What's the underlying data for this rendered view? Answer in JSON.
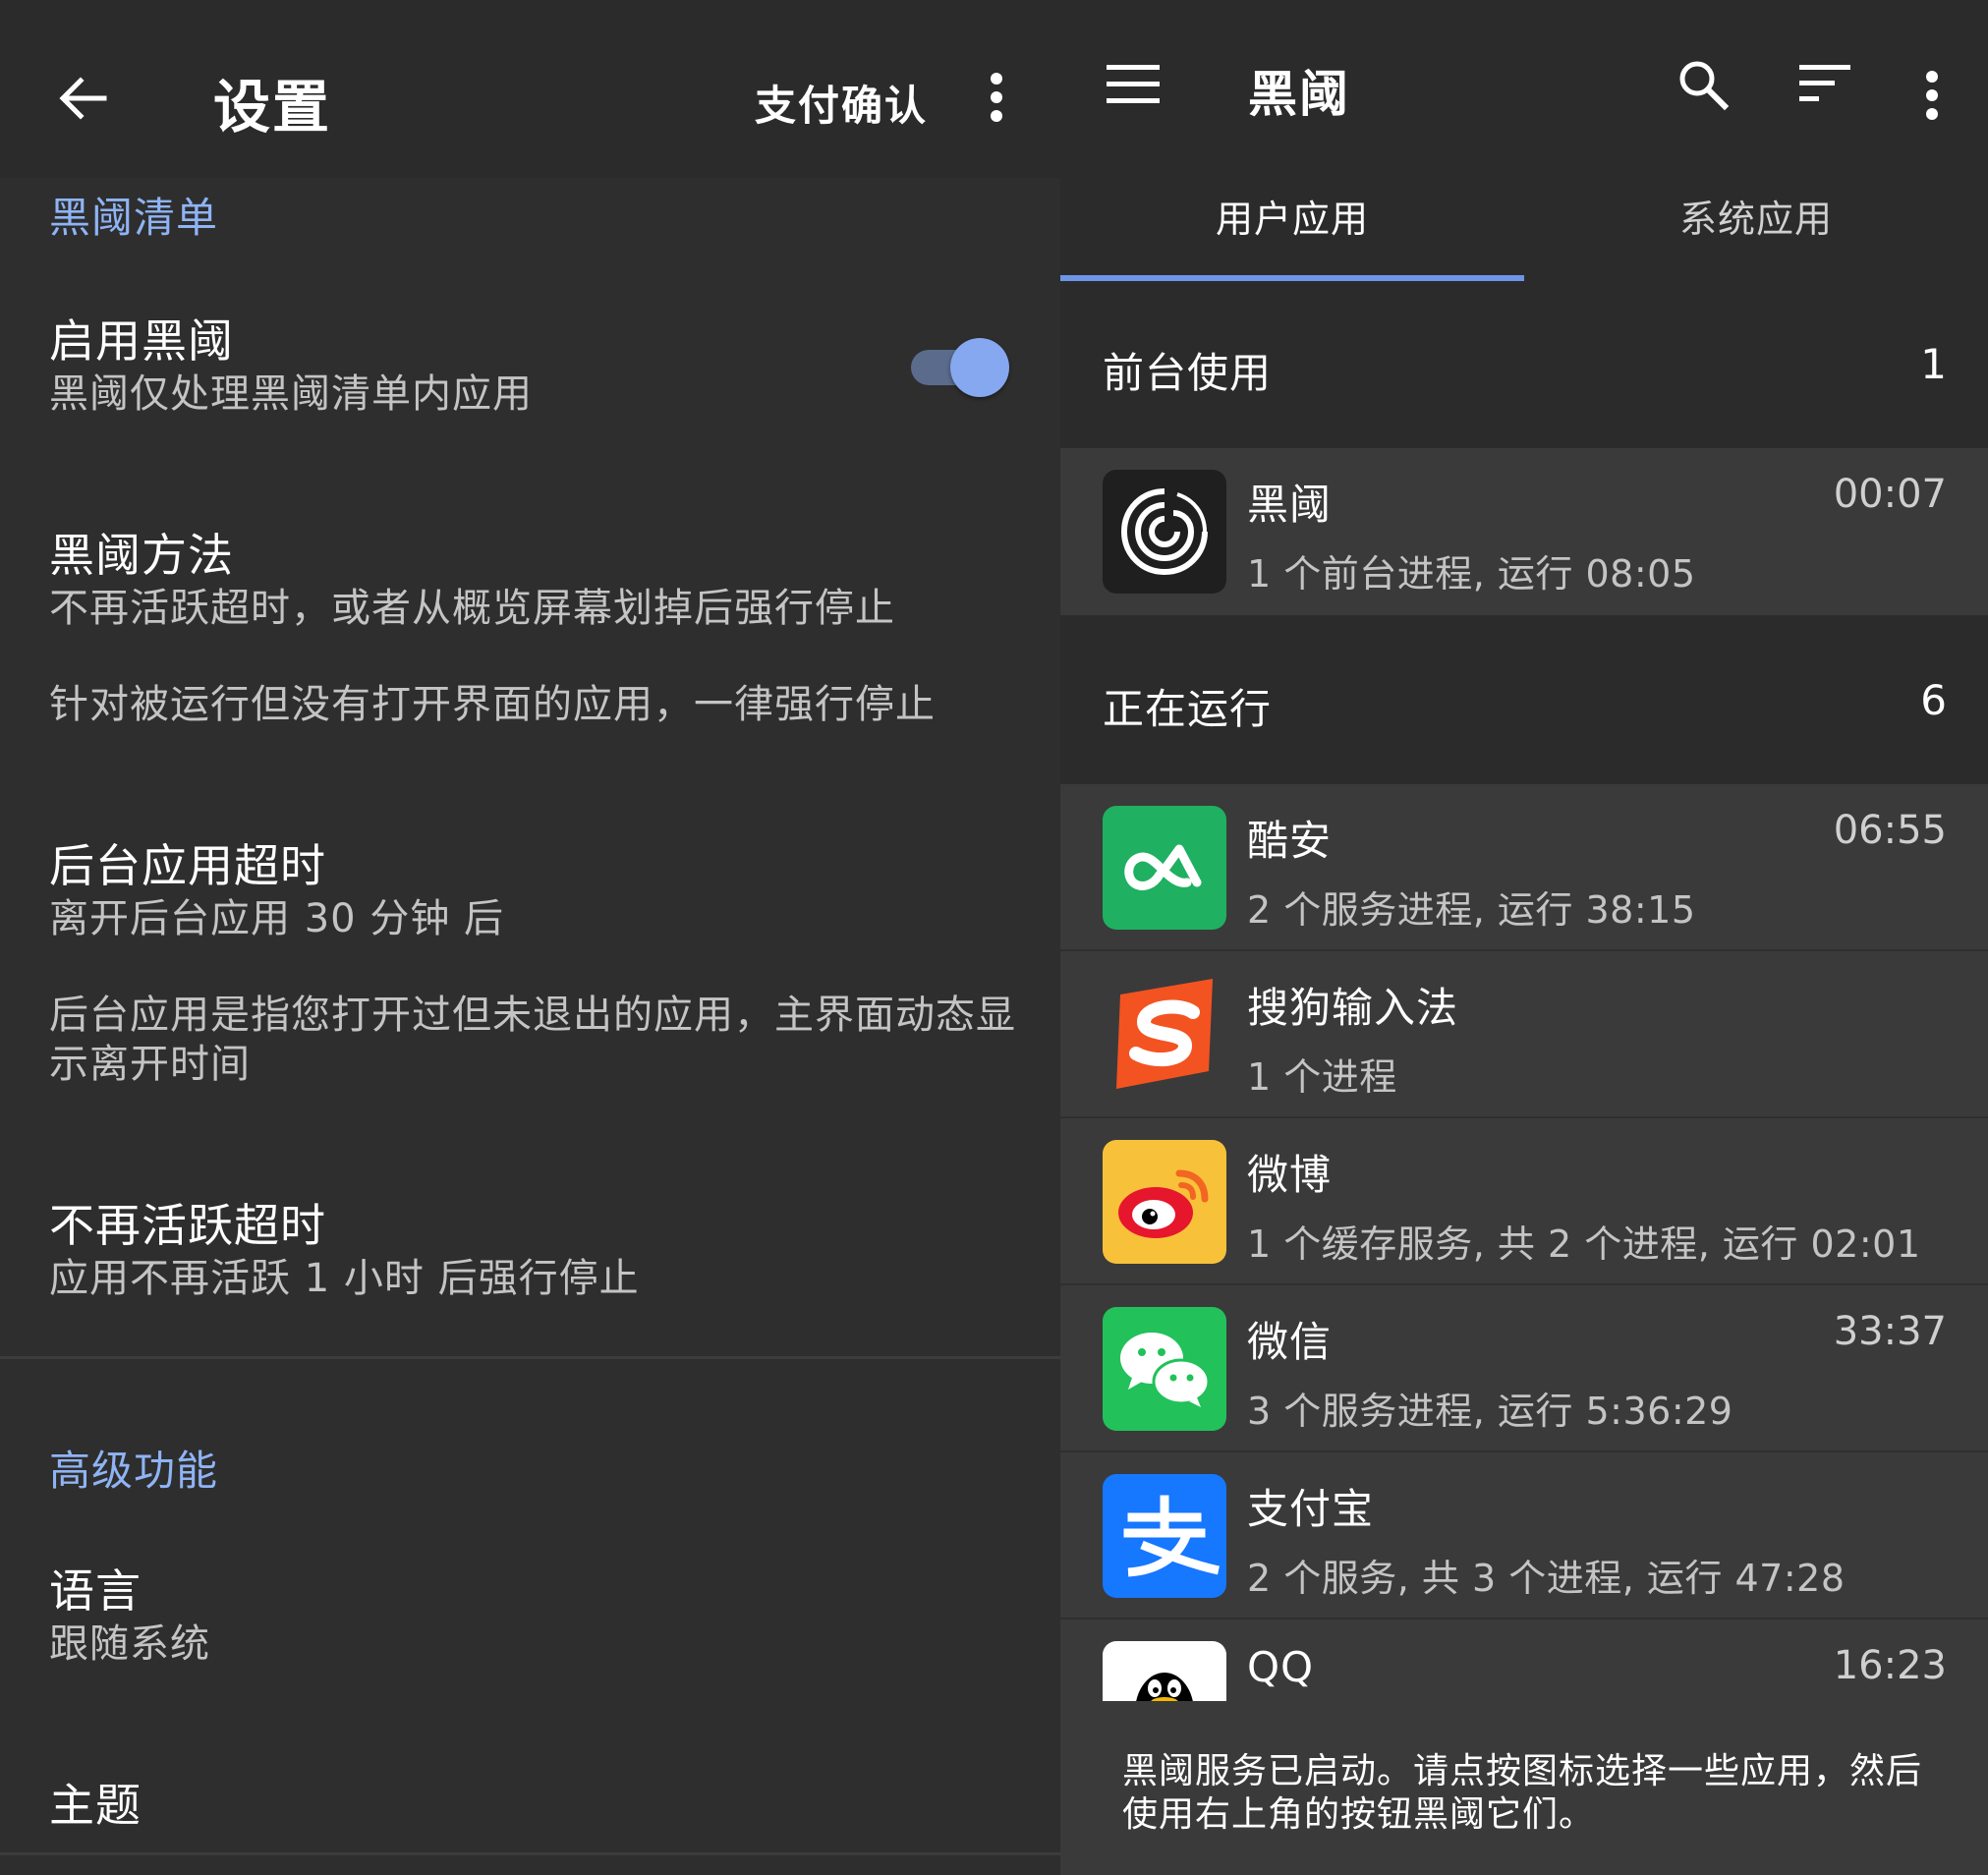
{
  "settings": {
    "title": "设置",
    "pay_confirm_label": "支付确认",
    "sections": {
      "blacklist_header": "黑阈清单",
      "advanced_header": "高级功能"
    },
    "enable": {
      "title": "启用黑阈",
      "summary": "黑阈仅处理黑阈清单内应用",
      "enabled": true
    },
    "method": {
      "title": "黑阈方法",
      "summary": "不再活跃超时，或者从概览屏幕划掉后强行停止",
      "note": "针对被运行但没有打开界面的应用，一律强行停止"
    },
    "background_timeout": {
      "title": "后台应用超时",
      "summary": "离开后台应用 30 分钟 后",
      "note": "后台应用是指您打开过但未退出的应用，主界面动态显示离开时间"
    },
    "inactive_timeout": {
      "title": "不再活跃超时",
      "summary": "应用不再活跃 1 小时 后强行停止"
    },
    "language": {
      "title": "语言",
      "summary": "跟随系统"
    },
    "theme": {
      "title": "主题"
    }
  },
  "main": {
    "title": "黑阈",
    "tabs": [
      {
        "label": "用户应用",
        "active": true
      },
      {
        "label": "系统应用",
        "active": false
      }
    ],
    "foreground": {
      "label": "前台使用",
      "count": "1",
      "apps": [
        {
          "name": "黑阈",
          "time": "00:07",
          "desc": "1 个前台进程, 运行 08:05",
          "icon": "brevent-swirl-icon"
        }
      ]
    },
    "running": {
      "label": "正在运行",
      "count": "6",
      "apps": [
        {
          "name": "酷安",
          "time": "06:55",
          "desc": "2 个服务进程, 运行 38:15",
          "icon": "coolapk-icon"
        },
        {
          "name": "搜狗输入法",
          "time": "",
          "desc": "1 个进程",
          "icon": "sogou-icon"
        },
        {
          "name": "微博",
          "time": "",
          "desc": "1 个缓存服务, 共 2 个进程, 运行 02:01",
          "icon": "weibo-icon"
        },
        {
          "name": "微信",
          "time": "33:37",
          "desc": "3 个服务进程, 运行 5:36:29",
          "icon": "wechat-icon"
        },
        {
          "name": "支付宝",
          "time": "",
          "desc": "2 个服务, 共 3 个进程, 运行 47:28",
          "icon": "alipay-icon"
        },
        {
          "name": "QQ",
          "time": "16:23",
          "desc": "",
          "icon": "qq-penguin-icon"
        }
      ]
    },
    "snackbar": "黑阈服务已启动。请点按图标选择一些应用，然后使用右上角的按钮黑阈它们。"
  },
  "colors": {
    "accent": "#8fb4f5",
    "tab_indicator": "#6d95e8",
    "background": "#2e2e2e",
    "row_background": "#3a3a3a",
    "coolapk_green": "#1fb062",
    "wechat_green": "#22c15a",
    "alipay_blue": "#1677ff",
    "sogou_orange": "#f35321",
    "weibo_yellow": "#f8c13a"
  }
}
